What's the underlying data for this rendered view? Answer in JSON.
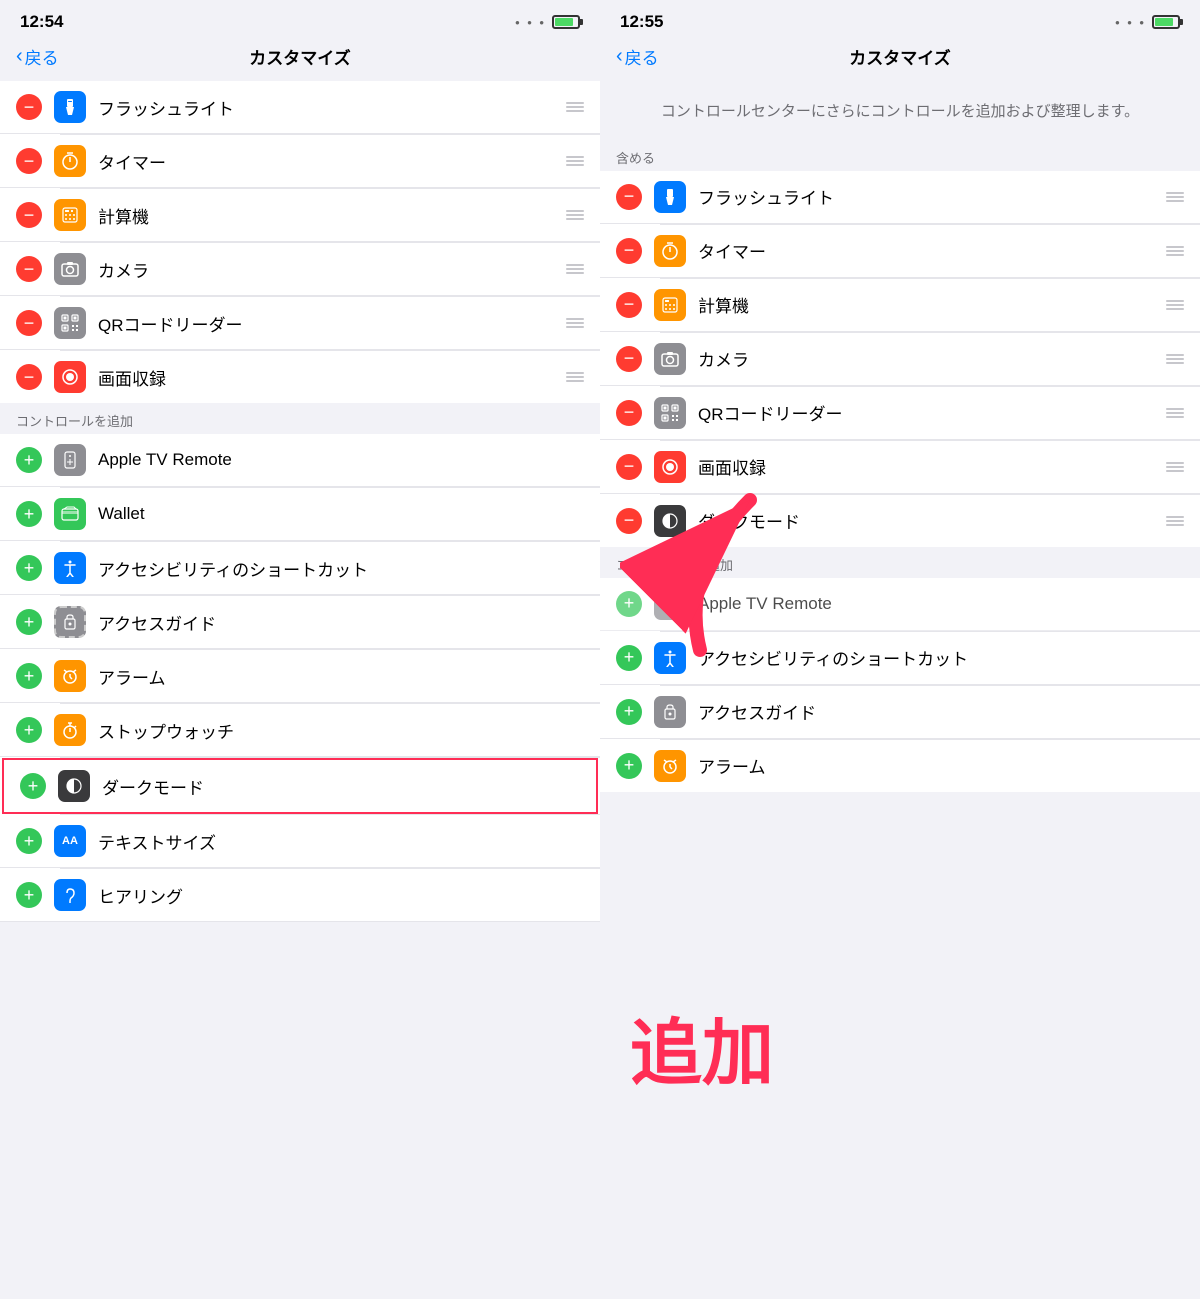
{
  "left_panel": {
    "status_bar": {
      "time": "12:54",
      "signal": "...",
      "battery": "charging"
    },
    "nav": {
      "back_label": "戻る",
      "title": "カスタマイズ"
    },
    "included_items": [
      {
        "id": "flashlight",
        "label": "フラッシュライト",
        "icon_color": "blue",
        "icon_char": "🔦",
        "toggle": "remove"
      },
      {
        "id": "timer",
        "label": "タイマー",
        "icon_color": "orange",
        "icon_char": "⏱",
        "toggle": "remove"
      },
      {
        "id": "calculator",
        "label": "計算機",
        "icon_color": "orange-calc",
        "icon_char": "⊞",
        "toggle": "remove"
      },
      {
        "id": "camera",
        "label": "カメラ",
        "icon_color": "gray",
        "icon_char": "📷",
        "toggle": "remove"
      },
      {
        "id": "qr",
        "label": "QRコードリーダー",
        "icon_color": "gray",
        "icon_char": "⊡",
        "toggle": "remove"
      },
      {
        "id": "screen-record",
        "label": "画面収録",
        "icon_color": "red-icon",
        "icon_char": "⊙",
        "toggle": "remove"
      }
    ],
    "add_section_label": "コントロールを追加",
    "add_items": [
      {
        "id": "apple-tv",
        "label": "Apple TV Remote",
        "icon_color": "gray",
        "icon_char": "▣",
        "toggle": "add"
      },
      {
        "id": "wallet",
        "label": "Wallet",
        "icon_color": "green",
        "icon_char": "▤",
        "toggle": "add"
      },
      {
        "id": "accessibility",
        "label": "アクセシビリティのショートカット",
        "icon_color": "blue",
        "icon_char": "♿",
        "toggle": "add"
      },
      {
        "id": "guided-access",
        "label": "アクセスガイド",
        "icon_color": "gray-dashed",
        "icon_char": "⊟",
        "toggle": "add"
      },
      {
        "id": "alarm",
        "label": "アラーム",
        "icon_color": "orange",
        "icon_char": "⏰",
        "toggle": "add"
      },
      {
        "id": "stopwatch",
        "label": "ストップウォッチ",
        "icon_color": "orange",
        "icon_char": "⊕",
        "toggle": "add"
      },
      {
        "id": "dark-mode",
        "label": "ダークモード",
        "icon_color": "dark-gray",
        "icon_char": "◑",
        "toggle": "add",
        "highlighted": true
      },
      {
        "id": "text-size",
        "label": "テキストサイズ",
        "icon_color": "blue",
        "icon_char": "AA",
        "toggle": "add"
      },
      {
        "id": "hearing",
        "label": "ヒアリング",
        "icon_color": "blue",
        "icon_char": "👂",
        "toggle": "add"
      }
    ]
  },
  "right_panel": {
    "status_bar": {
      "time": "12:55",
      "signal": "...",
      "battery": "charging"
    },
    "nav": {
      "back_label": "戻る",
      "title": "カスタマイズ"
    },
    "description": "コントロールセンターにさらにコントロールを追加および整理します。",
    "included_section_label": "含める",
    "included_items": [
      {
        "id": "flashlight",
        "label": "フラッシュライト",
        "icon_color": "blue",
        "icon_char": "🔦",
        "toggle": "remove"
      },
      {
        "id": "timer",
        "label": "タイマー",
        "icon_color": "orange",
        "icon_char": "⏱",
        "toggle": "remove"
      },
      {
        "id": "calculator",
        "label": "計算機",
        "icon_color": "orange-calc",
        "icon_char": "⊞",
        "toggle": "remove"
      },
      {
        "id": "camera",
        "label": "カメラ",
        "icon_color": "gray",
        "icon_char": "📷",
        "toggle": "remove"
      },
      {
        "id": "qr",
        "label": "QRコードリーダー",
        "icon_color": "gray",
        "icon_char": "⊡",
        "toggle": "remove"
      },
      {
        "id": "screen-record",
        "label": "画面収録",
        "icon_color": "red-icon",
        "icon_char": "⊙",
        "toggle": "remove"
      },
      {
        "id": "dark-mode",
        "label": "ダークモード",
        "icon_color": "dark-gray",
        "icon_char": "◑",
        "toggle": "remove"
      }
    ],
    "add_section_label": "コントロールを追加",
    "add_items": [
      {
        "id": "apple-tv",
        "label": "Apple TV Remote",
        "icon_color": "gray",
        "icon_char": "▣",
        "toggle": "add"
      },
      {
        "id": "accessibility",
        "label": "アクセシビリティのショートカット",
        "icon_color": "blue",
        "icon_char": "♿",
        "toggle": "add"
      },
      {
        "id": "guided-access",
        "label": "アクセスガイド",
        "icon_color": "gray-dashed",
        "icon_char": "⊟",
        "toggle": "add"
      },
      {
        "id": "alarm",
        "label": "アラーム",
        "icon_color": "orange",
        "icon_char": "⏰",
        "toggle": "add"
      }
    ],
    "tsuika_label": "追加"
  },
  "icons": {
    "flashlight": "💡",
    "timer": "⏱",
    "calculator": "📱",
    "camera": "📷",
    "qr": "QR",
    "screen-record": "⏺",
    "apple-tv": "📺",
    "wallet": "💳",
    "accessibility": "♿",
    "guided-access": "🔒",
    "alarm": "⏰",
    "stopwatch": "⏱",
    "dark-mode": "◑",
    "text-size": "Aa",
    "hearing": "👂"
  }
}
